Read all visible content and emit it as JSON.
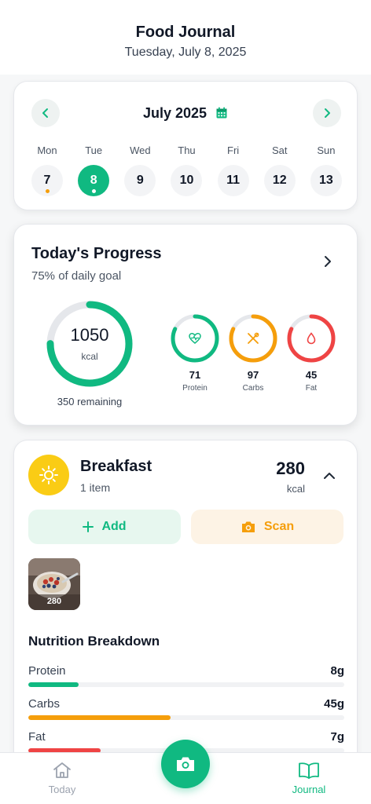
{
  "header": {
    "title": "Food Journal",
    "date": "Tuesday, July 8, 2025"
  },
  "calendar": {
    "month_label": "July 2025",
    "days": [
      {
        "name": "Mon",
        "num": "7",
        "selected": false,
        "dot": "#f59e0b"
      },
      {
        "name": "Tue",
        "num": "8",
        "selected": true,
        "dot": "#ffffff"
      },
      {
        "name": "Wed",
        "num": "9",
        "selected": false,
        "dot": ""
      },
      {
        "name": "Thu",
        "num": "10",
        "selected": false,
        "dot": ""
      },
      {
        "name": "Fri",
        "num": "11",
        "selected": false,
        "dot": ""
      },
      {
        "name": "Sat",
        "num": "12",
        "selected": false,
        "dot": ""
      },
      {
        "name": "Sun",
        "num": "13",
        "selected": false,
        "dot": ""
      }
    ]
  },
  "progress": {
    "title": "Today's Progress",
    "subtitle": "75% of daily goal",
    "calories": "1050",
    "calories_unit": "kcal",
    "calories_fraction": 0.75,
    "remaining": "350 remaining",
    "macros": [
      {
        "value": "71",
        "label": "Protein",
        "color": "#10b981",
        "fraction": 0.82,
        "icon": "heart-pulse-icon"
      },
      {
        "value": "97",
        "label": "Carbs",
        "color": "#f59e0b",
        "fraction": 0.82,
        "icon": "utensils-icon"
      },
      {
        "value": "45",
        "label": "Fat",
        "color": "#ef4444",
        "fraction": 0.82,
        "icon": "drop-icon"
      }
    ]
  },
  "meal": {
    "name": "Breakfast",
    "items": "1 item",
    "kcal": "280",
    "kcal_unit": "kcal",
    "add_label": "Add",
    "scan_label": "Scan",
    "food_kcal": "280",
    "nutrition_title": "Nutrition Breakdown",
    "nutrition": [
      {
        "label": "Protein",
        "value": "8g",
        "color": "#10b981",
        "fraction": 0.16
      },
      {
        "label": "Carbs",
        "value": "45g",
        "color": "#f59e0b",
        "fraction": 0.45
      },
      {
        "label": "Fat",
        "value": "7g",
        "color": "#ef4444",
        "fraction": 0.23
      }
    ]
  },
  "nav": {
    "today": "Today",
    "journal": "Journal",
    "today_color": "#9ca3af",
    "journal_color": "#10b981"
  },
  "colors": {
    "accent": "#10b981",
    "orange": "#f59e0b",
    "red": "#ef4444"
  }
}
